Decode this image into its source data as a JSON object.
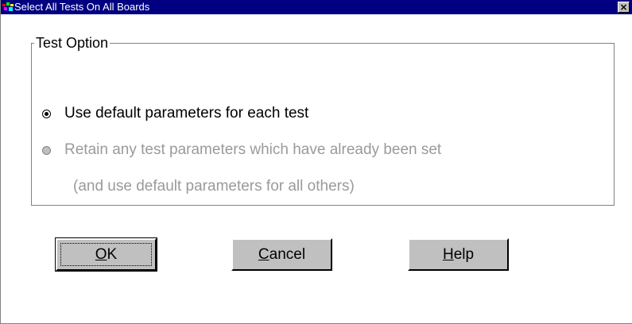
{
  "window": {
    "title": "Select All Tests On All Boards",
    "close_label": "×"
  },
  "group": {
    "label": "Test Option"
  },
  "options": [
    {
      "label": "Use default parameters for each test",
      "selected": true,
      "enabled": true
    },
    {
      "label": "Retain any test parameters which have already been set",
      "label_line2": "(and use default parameters for all others)",
      "selected": false,
      "enabled": false
    }
  ],
  "buttons": {
    "ok": {
      "mnemonic": "O",
      "rest": "K"
    },
    "cancel": {
      "mnemonic": "C",
      "rest": "ancel"
    },
    "help": {
      "mnemonic": "H",
      "rest": "elp"
    }
  },
  "colors": {
    "titlebar": "#000080",
    "face": "#c0c0c0",
    "disabled_text": "#9a9a9a"
  },
  "icons": {
    "app": "app-icon",
    "close": "close-icon",
    "radio_on": "radio-selected-icon",
    "radio_off": "radio-disabled-icon"
  }
}
